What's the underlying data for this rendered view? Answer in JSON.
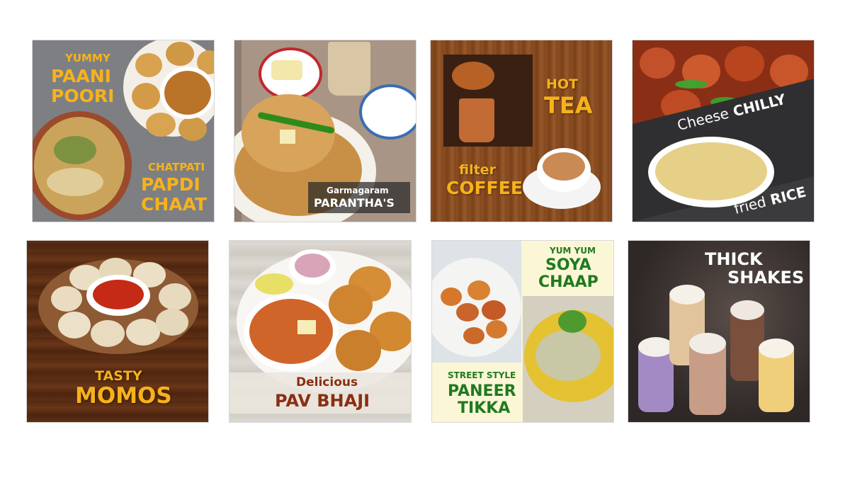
{
  "tiles": {
    "paani_poori": {
      "line1": "YUMMY",
      "line2": "PAANI",
      "line3": "POORI",
      "line4": "CHATPATI",
      "line5": "PAPDI",
      "line6": "CHAAT"
    },
    "paranthas": {
      "line1": "Garmagaram",
      "line2": "PARANTHA'S"
    },
    "tea_coffee": {
      "line1": "HOT",
      "line2": "TEA",
      "line3": "filter",
      "line4": "COFFEE"
    },
    "chinese": {
      "line1": "Cheese",
      "line2": "CHILLY",
      "line3": "fried",
      "line4": "RICE"
    },
    "momos": {
      "line1": "TASTY",
      "line2": "MOMOS"
    },
    "pav_bhaji": {
      "line1": "Delicious",
      "line2": "PAV BHAJI"
    },
    "soya_paneer": {
      "line1": "YUM YUM",
      "line2": "SOYA",
      "line3": "CHAAP",
      "line4": "STREET STYLE",
      "line5": "PANEER",
      "line6": "TIKKA"
    },
    "shakes": {
      "line1": "THICK",
      "line2": "SHAKES"
    }
  },
  "colors": {
    "accent_yellow": "#f7b21b",
    "dark_green": "#1f7a1f",
    "maroon": "#8a2f12",
    "cream": "#fbf6d6"
  }
}
